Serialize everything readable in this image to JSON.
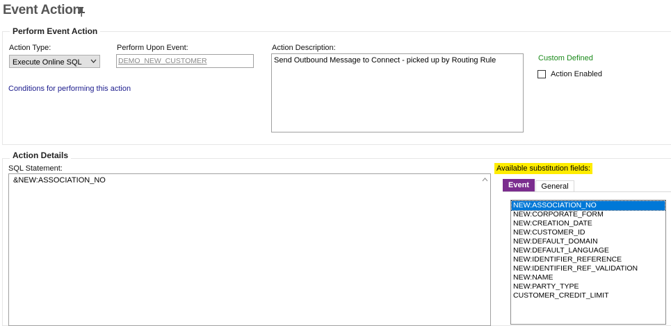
{
  "page": {
    "title": "Event Action",
    "pin_icon": "pin-icon"
  },
  "perform_event_action": {
    "group_title": "Perform Event Action",
    "action_type_label": "Action Type:",
    "action_type_value": "Execute Online SQL",
    "perform_upon_event_label": "Perform Upon Event:",
    "perform_upon_event_value": "DEMO_NEW_CUSTOMER",
    "action_description_label": "Action Description:",
    "action_description_value": "Send Outbound Message to Connect - picked up by Routing Rule",
    "conditions_link": "Conditions for performing this action",
    "custom_defined": "Custom Defined",
    "action_enabled_label": "Action Enabled",
    "action_enabled_checked": false
  },
  "action_details": {
    "group_title": "Action Details",
    "sql_statement_label": "SQL Statement:",
    "sql_statement_value": "&NEW:ASSOCIATION_NO",
    "substitution_label": "Available substitution fields:",
    "tabs": [
      {
        "label": "Event",
        "active": true
      },
      {
        "label": "General",
        "active": false
      }
    ],
    "fields": [
      "NEW:ASSOCIATION_NO",
      "NEW:CORPORATE_FORM",
      "NEW:CREATION_DATE",
      "NEW:CUSTOMER_ID",
      "NEW:DEFAULT_DOMAIN",
      "NEW:DEFAULT_LANGUAGE",
      "NEW:IDENTIFIER_REFERENCE",
      "NEW:IDENTIFIER_REF_VALIDATION",
      "NEW:NAME",
      "NEW:PARTY_TYPE",
      "CUSTOMER_CREDIT_LIMIT"
    ],
    "selected_field": "NEW:ASSOCIATION_NO"
  },
  "colors": {
    "custom_defined": "#1a8a1a",
    "link": "#1a1a8c",
    "active_tab": "#7b2d8e",
    "highlight": "#ffec00",
    "selection": "#0078d7"
  }
}
